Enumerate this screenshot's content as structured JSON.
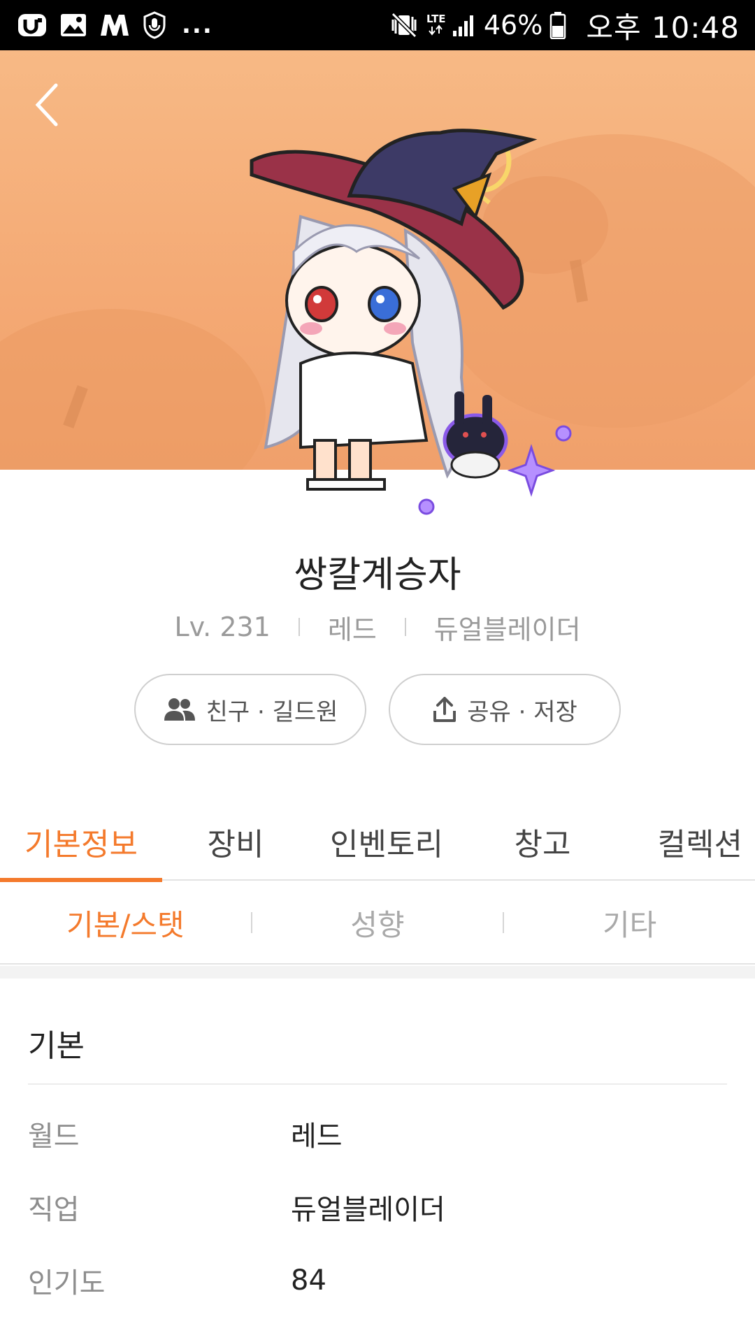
{
  "status_bar": {
    "overflow_dots": "...",
    "battery": "46%",
    "time": "오후 10:48",
    "network": "LTE"
  },
  "character": {
    "name": "쌍칼계승자",
    "level": "Lv. 231",
    "world": "레드",
    "job": "듀얼블레이더"
  },
  "actions": {
    "friends_label": "친구 · 길드원",
    "share_label": "공유 · 저장"
  },
  "main_tabs": [
    {
      "label": "기본정보",
      "active": true
    },
    {
      "label": "장비"
    },
    {
      "label": "인벤토리"
    },
    {
      "label": "창고"
    },
    {
      "label": "컬렉션"
    }
  ],
  "sub_tabs": [
    {
      "label": "기본/스탯",
      "active": true
    },
    {
      "label": "성향"
    },
    {
      "label": "기타"
    }
  ],
  "basic": {
    "title": "기본",
    "rows": [
      {
        "label": "월드",
        "value": "레드"
      },
      {
        "label": "직업",
        "value": "듀얼블레이더"
      },
      {
        "label": "인기도",
        "value": "84"
      }
    ]
  },
  "colors": {
    "accent": "#f47a2c",
    "banner": "#f4a974"
  }
}
